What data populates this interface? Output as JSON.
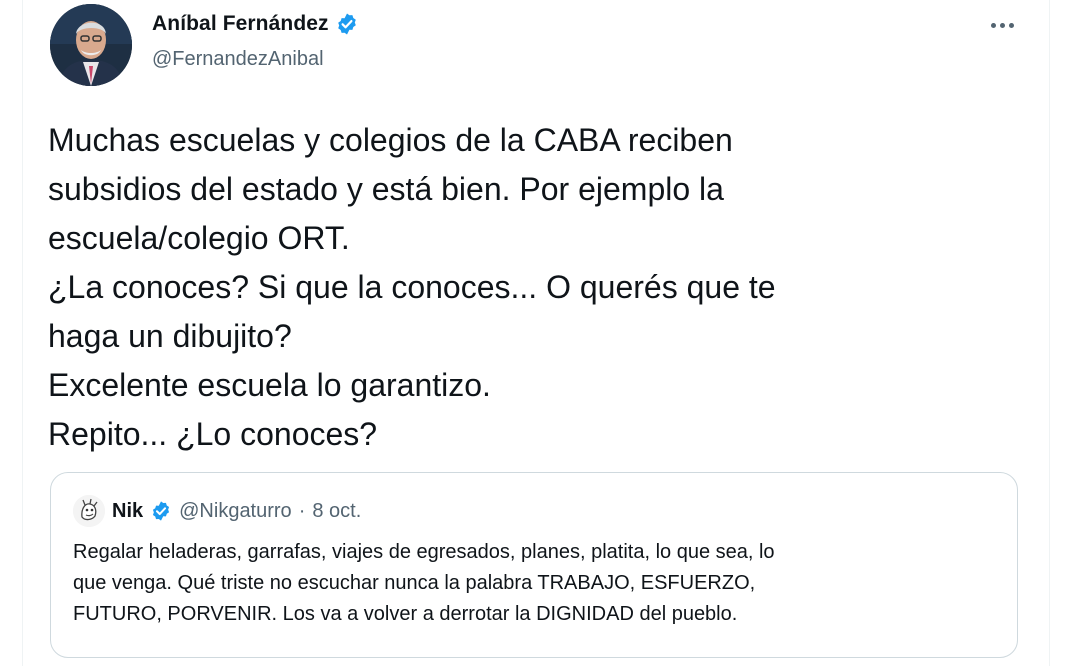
{
  "tweet": {
    "author": {
      "display_name": "Aníbal Fernández",
      "handle": "@FernandezAnibal",
      "verified_icon": "verified-badge-icon"
    },
    "more_icon": "more-options-icon",
    "text_lines": [
      "Muchas escuelas y colegios de la CABA reciben",
      "subsidios del estado y está bien. Por ejemplo la",
      "escuela/colegio ORT.",
      "¿La conoces? Si que la conoces... O querés que te",
      "haga un dibujito?",
      "Excelente escuela lo garantizo.",
      "Repito... ¿Lo conoces?"
    ]
  },
  "quoted_tweet": {
    "author": {
      "display_name": "Nik",
      "handle": "@Nikgaturro",
      "verified_icon": "verified-badge-icon"
    },
    "separator": "·",
    "date": "8 oct.",
    "text_lines": [
      "Regalar heladeras, garrafas, viajes de egresados, planes, platita, lo que sea, lo",
      "que venga. Qué triste no escuchar nunca la palabra TRABAJO, ESFUERZO,",
      "FUTURO, PORVENIR. Los va a volver a derrotar la DIGNIDAD del pueblo."
    ]
  },
  "colors": {
    "text_primary": "#0f1419",
    "text_secondary": "#536471",
    "verified_blue": "#1d9bf0",
    "border": "#cfd9de"
  }
}
